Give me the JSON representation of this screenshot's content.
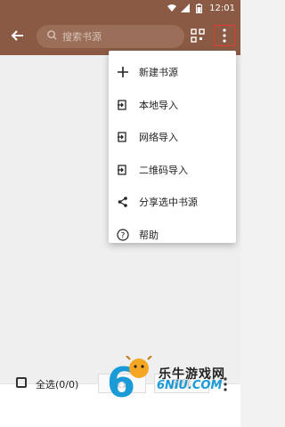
{
  "status_bar": {
    "time": "12:01",
    "icons": [
      "wifi-icon",
      "signal-icon",
      "battery-icon"
    ]
  },
  "toolbar": {
    "back_icon": "arrow-left-icon",
    "search": {
      "placeholder": "搜索书源",
      "icon": "search-icon"
    },
    "qr_icon": "qr-scan-icon",
    "more_icon": "more-vertical-icon"
  },
  "menu": {
    "items": [
      {
        "label": "新建书源",
        "icon": "plus-icon"
      },
      {
        "label": "本地导入",
        "icon": "import-icon"
      },
      {
        "label": "网络导入",
        "icon": "import-icon"
      },
      {
        "label": "二维码导入",
        "icon": "import-icon"
      },
      {
        "label": "分享选中书源",
        "icon": "share-icon"
      },
      {
        "label": "帮助",
        "icon": "help-icon"
      }
    ]
  },
  "bottom_bar": {
    "select_all_label": "全选(0/0)",
    "invert_label": "反选",
    "delete_label": "删除",
    "more_icon": "more-vertical-icon"
  },
  "watermark": {
    "text": "乐牛游戏网",
    "sub": "6NiU.COM"
  },
  "colors": {
    "toolbar": "#8a5a44",
    "accent": "#e23a2f",
    "link": "#1a9bd7"
  }
}
